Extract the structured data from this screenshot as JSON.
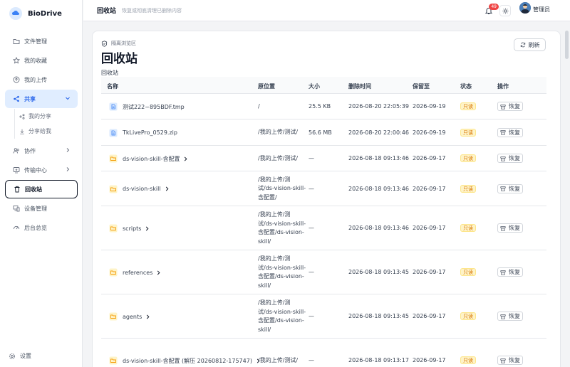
{
  "brand": {
    "name": "BioDrive"
  },
  "sidebar": {
    "items": [
      {
        "label": "文件管理",
        "icon": "folder-icon"
      },
      {
        "label": "我的收藏",
        "icon": "star-icon"
      },
      {
        "label": "我的上传",
        "icon": "upload-icon"
      },
      {
        "label": "共享",
        "icon": "share-icon"
      },
      {
        "label": "协作",
        "icon": "users-icon"
      },
      {
        "label": "传输中心",
        "icon": "transfer-icon"
      },
      {
        "label": "回收站",
        "icon": "trash-icon"
      },
      {
        "label": "设备管理",
        "icon": "device-icon"
      },
      {
        "label": "后台总览",
        "icon": "dashboard-icon"
      }
    ],
    "share_sub": [
      {
        "label": "我的分享"
      },
      {
        "label": "分享给我"
      }
    ],
    "settings": "设置"
  },
  "topbar": {
    "title": "回收站",
    "desc": "恢复或彻底清理已删除内容",
    "notifications": "49",
    "username": "管理员"
  },
  "page": {
    "breadcrumb": "隔离浏览区",
    "title": "回收站",
    "subtitle": "回收站",
    "refresh": "刷新"
  },
  "table": {
    "headers": [
      "名称",
      "原位置",
      "大小",
      "删除时间",
      "保留至",
      "状态",
      "操作"
    ],
    "rows": [
      {
        "type": "file",
        "name": "测试222~895BDF.tmp",
        "loc": "/",
        "size": "25.5 KB",
        "deleted": "2026-08-20 22:05:39",
        "keep": "2026-09-19",
        "status": "只读",
        "action": "恢复"
      },
      {
        "type": "file",
        "name": "TkLivePro_0529.zip",
        "loc": "/我的上传/测试/",
        "size": "56.6 MB",
        "deleted": "2026-08-20 22:00:46",
        "keep": "2026-09-19",
        "status": "只读",
        "action": "恢复"
      },
      {
        "type": "folder",
        "name": "ds-vision-skill-含配置",
        "loc": "/我的上传/测试/",
        "size": "—",
        "deleted": "2026-08-18 09:13:46",
        "keep": "2026-09-17",
        "status": "只读",
        "action": "恢复"
      },
      {
        "type": "folder",
        "name": "ds-vision-skill",
        "loc": "/我的上传/测试/ds-vision-skill-含配置/",
        "size": "—",
        "deleted": "2026-08-18 09:13:46",
        "keep": "2026-09-17",
        "status": "只读",
        "action": "恢复"
      },
      {
        "type": "folder",
        "name": "scripts",
        "loc": "/我的上传/测试/ds-vision-skill-含配置/ds-vision-skill/",
        "size": "—",
        "deleted": "2026-08-18 09:13:46",
        "keep": "2026-09-17",
        "status": "只读",
        "action": "恢复"
      },
      {
        "type": "folder",
        "name": "references",
        "loc": "/我的上传/测试/ds-vision-skill-含配置/ds-vision-skill/",
        "size": "—",
        "deleted": "2026-08-18 09:13:45",
        "keep": "2026-09-17",
        "status": "只读",
        "action": "恢复"
      },
      {
        "type": "folder",
        "name": "agents",
        "loc": "/我的上传/测试/ds-vision-skill-含配置/ds-vision-skill/",
        "size": "—",
        "deleted": "2026-08-18 09:13:45",
        "keep": "2026-09-17",
        "status": "只读",
        "action": "恢复"
      },
      {
        "type": "folder",
        "name": "ds-vision-skill-含配置 (解压 20260812-175747)",
        "loc": "/我的上传/测试/",
        "size": "—",
        "deleted": "2026-08-18 09:13:17",
        "keep": "2026-09-17",
        "status": "只读",
        "action": "恢复"
      }
    ]
  }
}
